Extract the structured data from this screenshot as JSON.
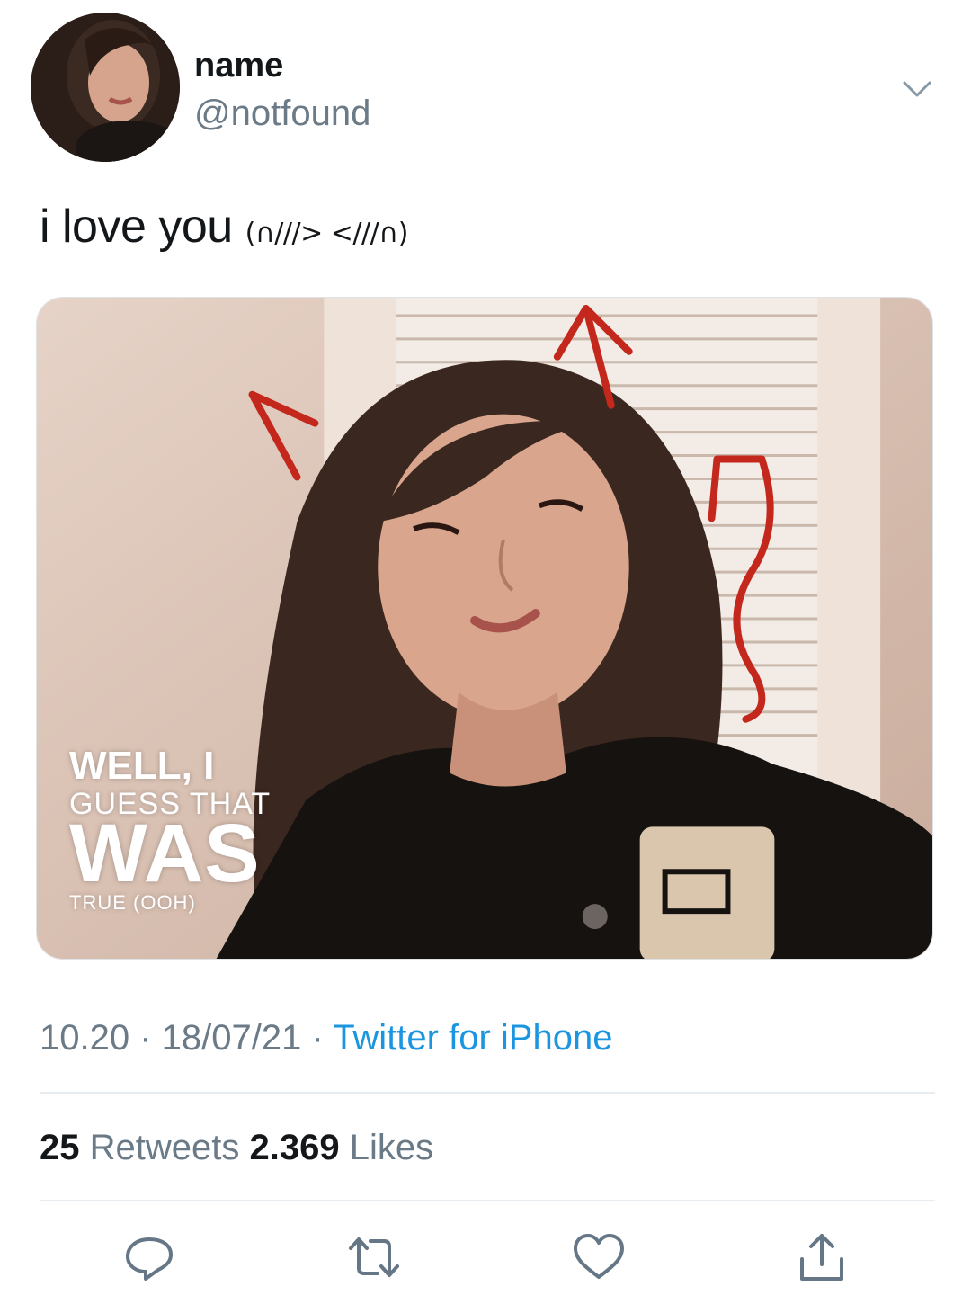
{
  "user": {
    "display_name": "name",
    "handle": "@notfound"
  },
  "tweet": {
    "text": "i love you",
    "kaomoji": "(∩///> <///∩)"
  },
  "media": {
    "overlay_lines": [
      "WELL, I",
      "GUESS THAT",
      "WAS",
      "TRUE (OOH)"
    ]
  },
  "meta": {
    "time": "10.20",
    "date": "18/07/21",
    "separator": " · ",
    "source": "Twitter for iPhone"
  },
  "stats": {
    "retweets_count": "25",
    "retweets_label": " Retweets ",
    "likes_count": "2.369",
    "likes_label": " Likes"
  },
  "icons": {
    "menu": "chevron-down-icon",
    "reply": "reply-icon",
    "retweet": "retweet-icon",
    "like": "heart-icon",
    "share": "share-icon"
  },
  "colors": {
    "link": "#1b95e0",
    "muted": "#6b7a87",
    "text": "#14171a",
    "doodle": "#c4281c"
  }
}
